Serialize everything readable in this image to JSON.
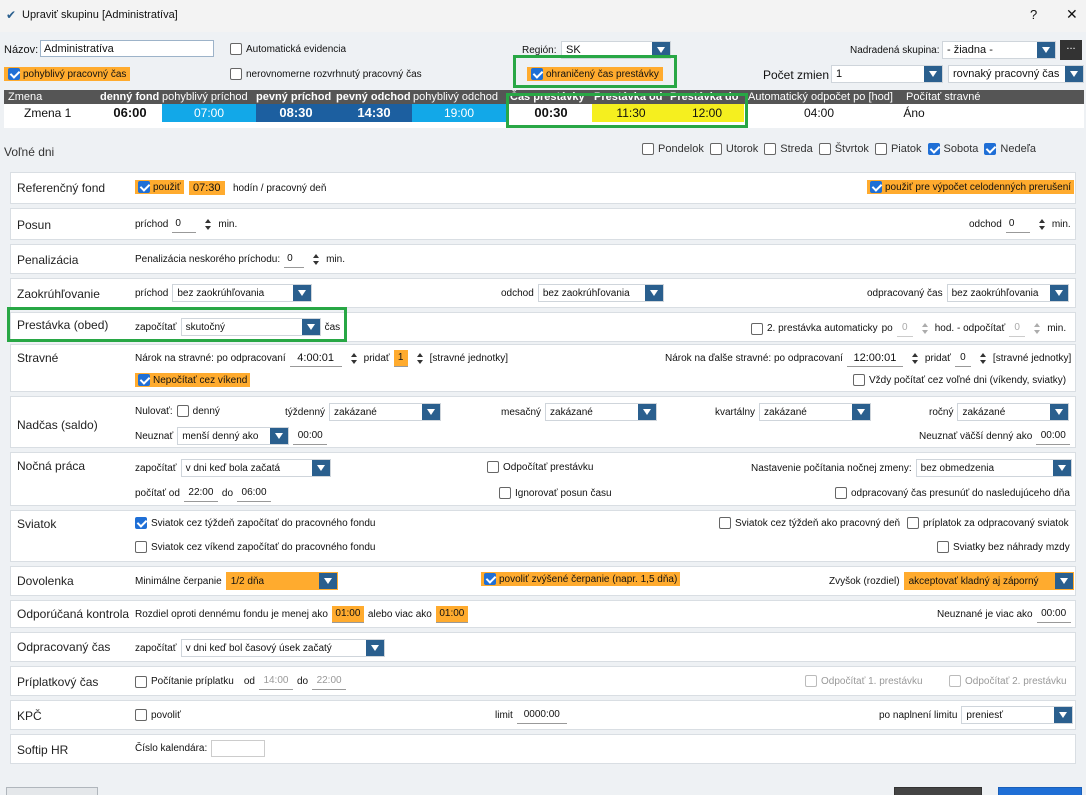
{
  "window": {
    "title": "Upraviť skupinu [Administratíva]",
    "help": "?",
    "close": "✕"
  },
  "top": {
    "nazov_label": "Názov:",
    "nazov_value": "Administratíva",
    "auto_evid": "Automatická evidencia",
    "region_label": "Región:",
    "region_value": "SK",
    "parent_label": "Nadradená skupina:",
    "parent_value": "- žiadna -",
    "more": "...",
    "flex_time": "pohyblivý pracovný čas",
    "uneven": "nerovnomerne rozvrhnutý pracovný čas",
    "limited_break": "ohraničený čas prestávky",
    "shifts_label": "Počet zmien",
    "shifts_value": "1",
    "uniform": "rovnaký pracovný čas"
  },
  "shift_table": {
    "headers": [
      "Zmena",
      "denný fond",
      "pohyblivý príchod",
      "pevný príchod",
      "pevný odchod",
      "pohyblivý odchod",
      "Čas prestávky",
      "Prestávka od",
      "Prestávka do",
      "Automatický odpočet po [hod]",
      "Počítať stravné"
    ],
    "row": {
      "name": "Zmena 1",
      "fond": "06:00",
      "flex_in": "07:00",
      "fixed_in": "08:30",
      "fixed_out": "14:30",
      "flex_out": "19:00",
      "break": "00:30",
      "break_from": "11:30",
      "break_to": "12:00",
      "auto": "04:00",
      "meals": "Áno"
    }
  },
  "free_days": {
    "label": "Voľné dni",
    "days": [
      {
        "name": "Pondelok",
        "on": false
      },
      {
        "name": "Utorok",
        "on": false
      },
      {
        "name": "Streda",
        "on": false
      },
      {
        "name": "Štvrtok",
        "on": false
      },
      {
        "name": "Piatok",
        "on": false
      },
      {
        "name": "Sobota",
        "on": true
      },
      {
        "name": "Nedeľa",
        "on": true
      }
    ]
  },
  "ref": {
    "label": "Referenčný fond",
    "use": "použiť",
    "hours": "07:30",
    "unit": "hodín / pracovný deň",
    "calc": "použiť pre výpočet celodenných prerušení"
  },
  "posun": {
    "label": "Posun",
    "in": "príchod",
    "in_v": "0",
    "min": "min.",
    "out": "odchod",
    "out_v": "0"
  },
  "pen": {
    "label": "Penalizácia",
    "text": "Penalizácia neskorého príchodu:",
    "v": "0",
    "min": "min."
  },
  "zaok": {
    "label": "Zaokrúhľovanie",
    "in": "príchod",
    "in_v": "bez zaokrúhľovania",
    "out": "odchod",
    "out_v": "bez zaokrúhľovania",
    "worked": "odpracovaný čas",
    "worked_v": "bez zaokrúhľovania"
  },
  "prest": {
    "label": "Prestávka (obed)",
    "count": "započítať",
    "count_v": "skutočný",
    "cas": "čas",
    "second": "2. prestávka automaticky",
    "po": "po",
    "po_v": "0",
    "hod": "hod. - odpočítať",
    "od_v": "0",
    "min": "min."
  },
  "strav": {
    "label": "Stravné",
    "n1": "Nárok na stravné: po odpracovaní",
    "n1_v": "4:00:01",
    "add": "pridať",
    "add_v": "1",
    "units": "[stravné jednotky]",
    "n2": "Nárok na ďalše stravné: po odpracovaní",
    "n2_v": "12:00:01",
    "add2_v": "0",
    "weekend": "Nepočítať cez víkend",
    "always": "Vždy počítať cez voľné dni (víkendy, sviatky)"
  },
  "nadcas": {
    "label": "Nadčas (saldo)",
    "nul": "Nulovať:",
    "daily": "denný",
    "weekly": "týždenný",
    "weekly_v": "zakázané",
    "monthly": "mesačný",
    "monthly_v": "zakázané",
    "quarterly": "kvartálny",
    "quarterly_v": "zakázané",
    "yearly": "ročný",
    "yearly_v": "zakázané",
    "neuz": "Neuznať",
    "neuz_v": "menší denný ako",
    "neuz_t": "00:00",
    "neuz2": "Neuznať väčší denný ako",
    "neuz2_t": "00:00"
  },
  "night": {
    "label": "Nočná práca",
    "count": "započítať",
    "count_v": "v dni keď bola začatá",
    "deduct": "Odpočítať prestávku",
    "setting": "Nastavenie počítania nočnej zmeny:",
    "setting_v": "bez obmedzenia",
    "from": "počítať od",
    "from_v": "22:00",
    "to": "do",
    "to_v": "06:00",
    "ignore": "Ignorovať posun času",
    "move": "odpracovaný čas presunúť do nasledujúceho dňa"
  },
  "holiday": {
    "label": "Sviatok",
    "a": "Sviatok cez týždeň započítať do pracovného fondu",
    "b": "Sviatok cez týždeň ako pracovný deň",
    "c": "príplatok za odpracovaný sviatok",
    "d": "Sviatok cez víkend započítať do pracovného fondu",
    "e": "Sviatky bez náhrady mzdy"
  },
  "vac": {
    "label": "Dovolenka",
    "min": "Minimálne čerpanie",
    "min_v": "1/2 dňa",
    "inc": "povoliť zvýšené čerpanie (napr. 1,5 dňa)",
    "rest": "Zvyšok (rozdiel)",
    "rest_v": "akceptovať kladný aj záporný"
  },
  "ctrl": {
    "label": "Odporúčaná kontrola",
    "text": "Rozdiel oproti dennému fondu je menej ako",
    "v1": "01:00",
    "or": "alebo viac ako",
    "v2": "01:00",
    "nu": "Neuznané je viac ako",
    "nu_v": "00:00"
  },
  "worked": {
    "label": "Odpracovaný čas",
    "count": "započítať",
    "count_v": "v dni keď bol časový úsek začatý"
  },
  "pripl": {
    "label": "Príplatkový čas",
    "calc": "Počítanie príplatku",
    "od": "od",
    "od_v": "14:00",
    "do": "do",
    "do_v": "22:00",
    "d1": "Odpočítať 1. prestávku",
    "d2": "Odpočítať 2. prestávku"
  },
  "kpc": {
    "label": "KPČ",
    "allow": "povoliť",
    "limit": "limit",
    "limit_v": "0000:00",
    "after": "po naplnení limitu",
    "after_v": "preniesť"
  },
  "softip": {
    "label": "Softip HR",
    "cal": "Číslo kalendára:"
  }
}
